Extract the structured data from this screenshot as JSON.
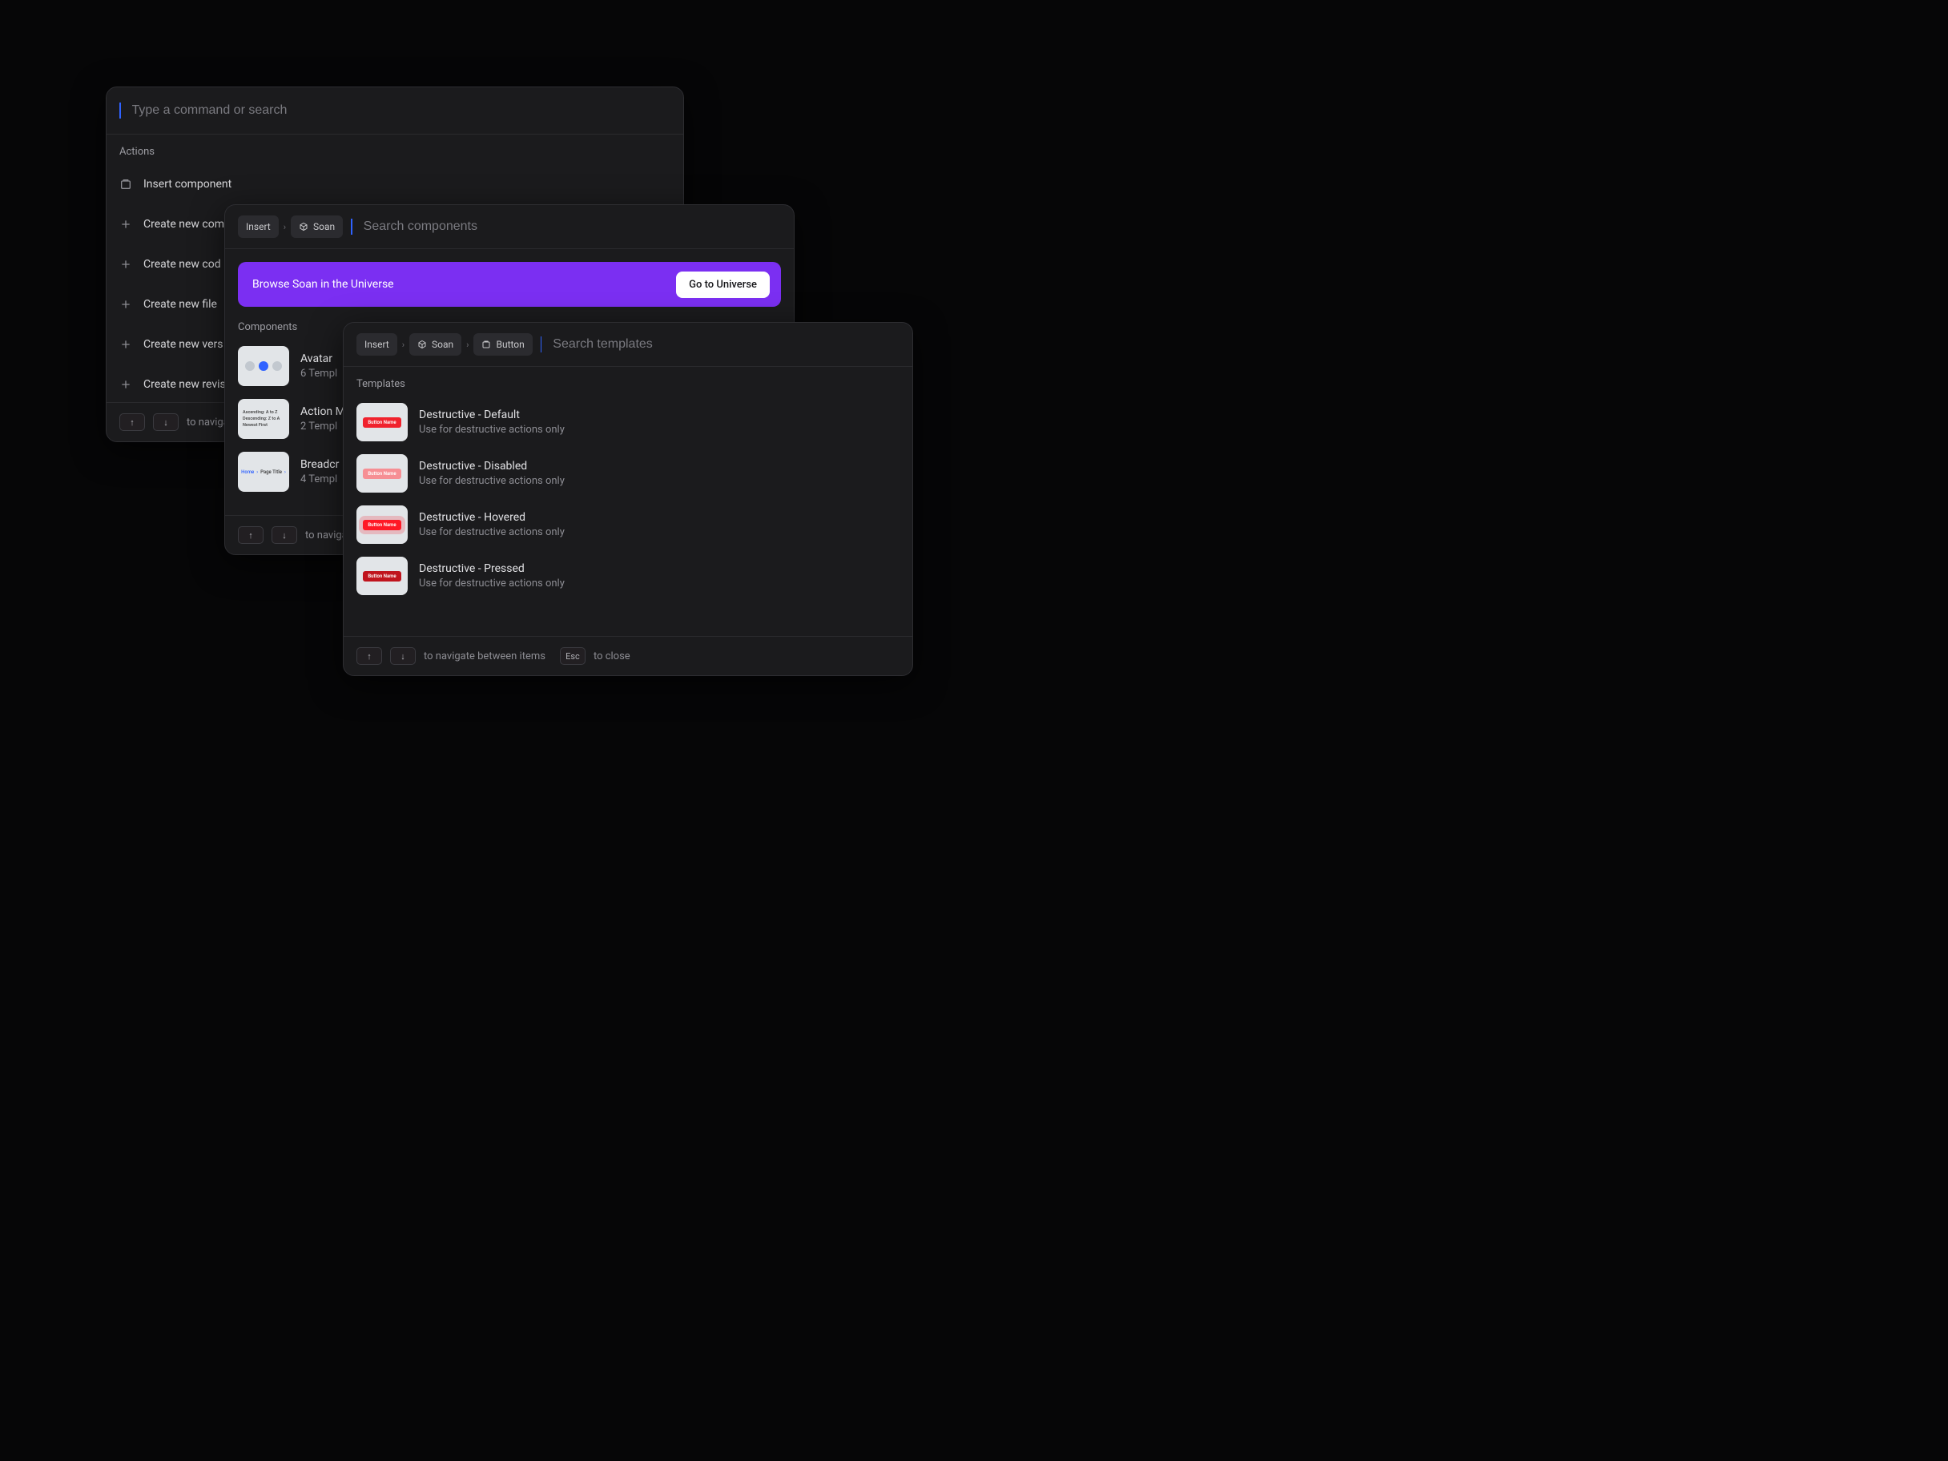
{
  "panelA": {
    "search_placeholder": "Type a command or search",
    "section": "Actions",
    "items": [
      {
        "icon": "component",
        "label": "Insert component"
      },
      {
        "icon": "plus",
        "label": "Create new com"
      },
      {
        "icon": "plus",
        "label": "Create new cod"
      },
      {
        "icon": "plus",
        "label": "Create new file"
      },
      {
        "icon": "plus",
        "label": "Create new vers"
      },
      {
        "icon": "plus",
        "label": "Create new revis"
      }
    ],
    "footer": {
      "nav": "to navigate"
    }
  },
  "panelB": {
    "crumbs": [
      {
        "label": "Insert"
      },
      {
        "icon": "package",
        "label": "Soan"
      }
    ],
    "search_placeholder": "Search components",
    "banner": {
      "text": "Browse Soan in the Universe",
      "cta": "Go to Universe"
    },
    "section": "Components",
    "items": [
      {
        "thumb": "avatar",
        "title": "Avatar",
        "sub": "6 Templ"
      },
      {
        "thumb": "menu",
        "title": "Action M",
        "sub": "2 Templ"
      },
      {
        "thumb": "bread",
        "title": "Breadcr",
        "sub": "4 Templ"
      }
    ],
    "footer": {
      "nav": "to navigate"
    }
  },
  "panelC": {
    "crumbs": [
      {
        "label": "Insert"
      },
      {
        "icon": "package",
        "label": "Soan"
      },
      {
        "icon": "component",
        "label": "Button"
      }
    ],
    "search_placeholder": "Search templates",
    "section": "Templates",
    "items": [
      {
        "variant": "default",
        "title": "Destructive - Default",
        "sub": "Use for destructive actions only"
      },
      {
        "variant": "disabled",
        "title": "Destructive - Disabled",
        "sub": "Use for destructive actions only"
      },
      {
        "variant": "hovered",
        "title": "Destructive - Hovered",
        "sub": "Use for destructive actions only"
      },
      {
        "variant": "pressed",
        "title": "Destructive - Pressed",
        "sub": "Use for destructive actions only"
      }
    ],
    "thumb_label": "Button Name",
    "footer": {
      "nav": "to navigate between items",
      "close": "to close",
      "esc": "Esc"
    }
  },
  "keys": {
    "up": "↑",
    "down": "↓"
  }
}
